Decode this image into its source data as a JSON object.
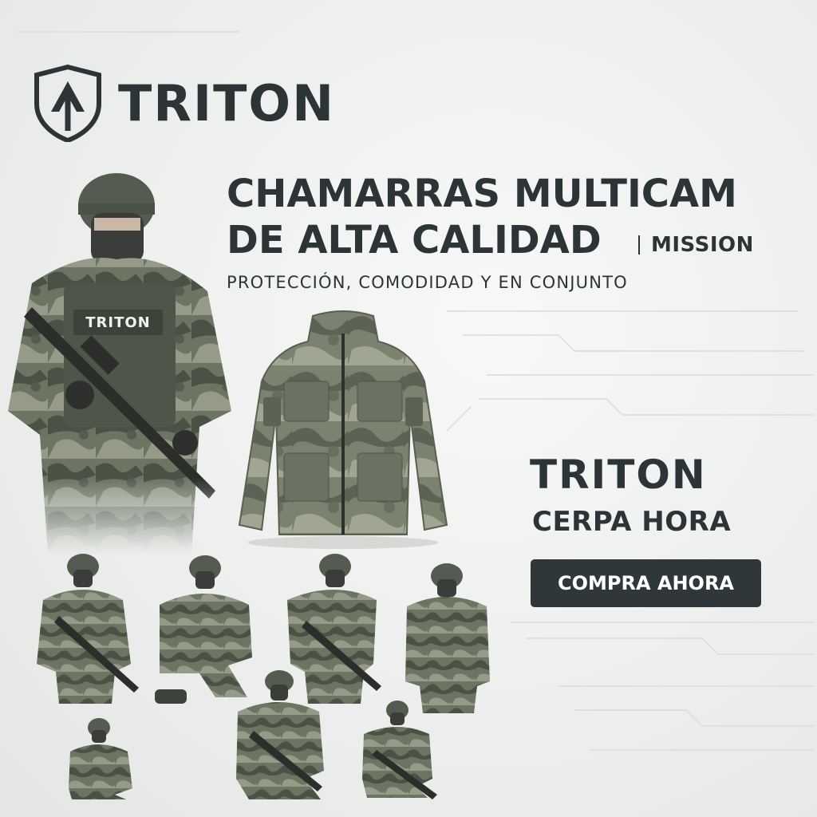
{
  "brand": {
    "name": "TRITON",
    "logo_icon": "shield-arrow-icon",
    "color": "#2c3438"
  },
  "headline": {
    "line1": "CHAMARRAS MULTICAM",
    "line2": "DE ALTA CALIDAD",
    "tag": "MISSION"
  },
  "subtitle": "PROTECCIÓN, COMODIDAD Y EN CONJUNTO",
  "vest_label": "TRITON",
  "cta": {
    "title": "TRITON",
    "subtitle": "CERPA HORA",
    "button_label": "COMPRA AHORA",
    "button_color": "#2f373b"
  },
  "colors": {
    "camo_dark": "#4a5145",
    "camo_mid": "#6c7462",
    "camo_light": "#959b88",
    "background": "#eceeed"
  }
}
